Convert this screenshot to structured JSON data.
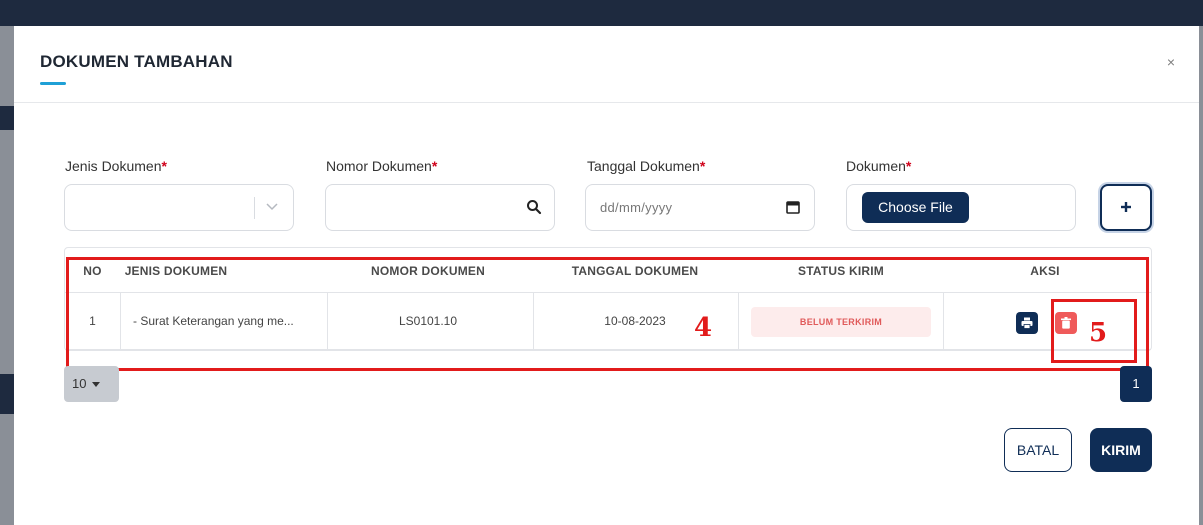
{
  "modal": {
    "title": "DOKUMEN TAMBAHAN",
    "close_glyph": "×"
  },
  "form": {
    "jenis_label": "Jenis Dokumen",
    "nomor_label": "Nomor Dokumen",
    "tanggal_label": "Tanggal Dokumen",
    "dokumen_label": "Dokumen",
    "required_mark": "*",
    "date_placeholder": "dd/mm/yyyy",
    "choose_file_label": "Choose File",
    "icons": [
      "chevron-down-icon",
      "search-icon",
      "calendar-icon",
      "plus-icon"
    ]
  },
  "table": {
    "headers": [
      "NO",
      "JENIS DOKUMEN",
      "NOMOR DOKUMEN",
      "TANGGAL DOKUMEN",
      "STATUS KIRIM",
      "AKSI"
    ],
    "rows": [
      {
        "no": "1",
        "jenis": "- Surat Keterangan yang me...",
        "nomor": "LS0101.10",
        "tanggal": "10-08-2023",
        "status": "BELUM TERKIRIM"
      }
    ],
    "action_icons": [
      "print-icon",
      "trash-icon"
    ]
  },
  "pagination": {
    "page_size": "10",
    "current_page": "1"
  },
  "footer": {
    "cancel_label": "BATAL",
    "submit_label": "KIRIM"
  },
  "annotations": {
    "label_4": "4",
    "label_5": "5"
  },
  "colors": {
    "navy": "#0f2d56",
    "accent": "#1fa0d6",
    "required": "#d0021b",
    "status_bg": "#fdecec",
    "status_text": "#e05a5a",
    "delete": "#ef5a5a",
    "annotation": "#e21b1b"
  }
}
